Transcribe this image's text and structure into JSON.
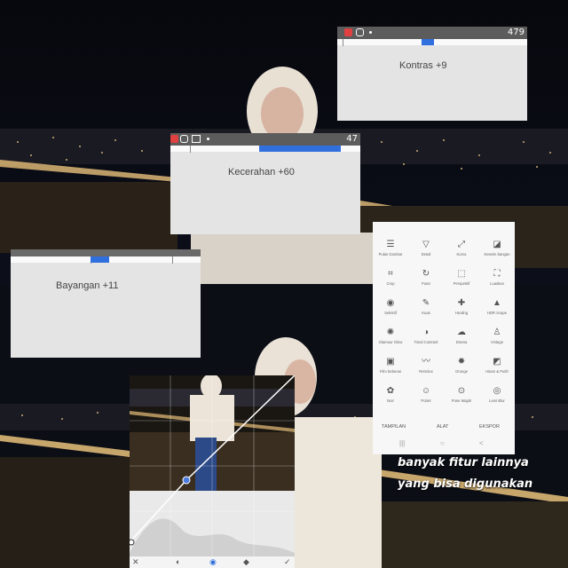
{
  "panels": {
    "kontras": {
      "label": "Kontras +9",
      "status_right": "479",
      "value": 9
    },
    "kecerahan": {
      "label": "Kecerahan +60",
      "status_right": "47",
      "value": 60
    },
    "bayangan": {
      "label": "Bayangan +11",
      "value": 11
    }
  },
  "tools": [
    {
      "label": "Pulas Gambar",
      "icon": "tune-icon"
    },
    {
      "label": "Detail",
      "icon": "triangle-down-icon"
    },
    {
      "label": "Kurva",
      "icon": "curves-icon"
    },
    {
      "label": "Keseim bangan",
      "icon": "white-balance-icon"
    },
    {
      "label": "Crop",
      "icon": "crop-icon"
    },
    {
      "label": "Putar",
      "icon": "rotate-icon"
    },
    {
      "label": "Perspektif",
      "icon": "perspective-icon"
    },
    {
      "label": "Luaskan",
      "icon": "expand-icon"
    },
    {
      "label": "Selektif",
      "icon": "selective-icon"
    },
    {
      "label": "Kuas",
      "icon": "brush-icon"
    },
    {
      "label": "Healing",
      "icon": "healing-icon"
    },
    {
      "label": "HDR Scape",
      "icon": "hdr-icon"
    },
    {
      "label": "Glamour Glow",
      "icon": "glow-icon"
    },
    {
      "label": "Tonal Contrast",
      "icon": "tonal-icon"
    },
    {
      "label": "Drama",
      "icon": "drama-icon"
    },
    {
      "label": "Vintage",
      "icon": "vintage-icon"
    },
    {
      "label": "Film beberas",
      "icon": "film-icon"
    },
    {
      "label": "Retrolux",
      "icon": "mustache-icon"
    },
    {
      "label": "Grunge",
      "icon": "grunge-icon"
    },
    {
      "label": "Hitam & Putih",
      "icon": "bw-icon"
    },
    {
      "label": "Noir",
      "icon": "noir-icon"
    },
    {
      "label": "Potret",
      "icon": "portrait-icon"
    },
    {
      "label": "Pose Wajah",
      "icon": "face-pose-icon"
    },
    {
      "label": "Lens Blur",
      "icon": "lens-blur-icon"
    }
  ],
  "tabs": [
    "TAMPILAN",
    "ALAT",
    "EKSPOR"
  ],
  "nav": [
    "|||",
    "○",
    "<"
  ],
  "curves_toolbar": [
    "✕",
    "◐",
    "◉",
    "◆",
    "✓"
  ],
  "caption": [
    "banyak fitur lainnya",
    "yang bisa digunakan"
  ]
}
